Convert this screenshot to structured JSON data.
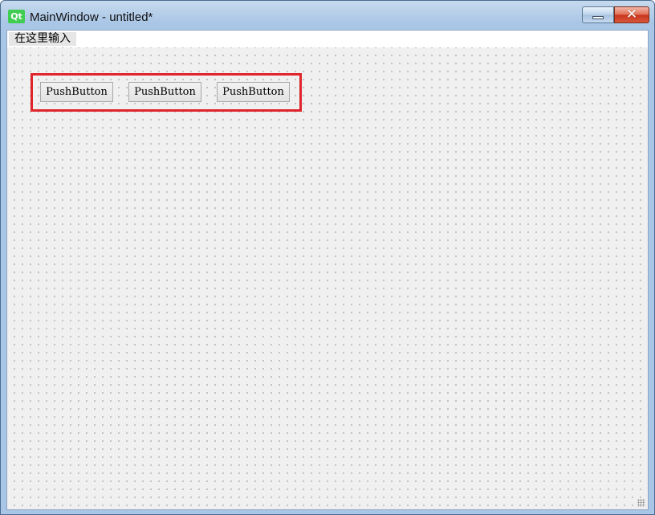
{
  "window": {
    "title": "MainWindow - untitled*",
    "app_icon_text": "Qt",
    "minimize_glyph": "",
    "close_glyph": "✕"
  },
  "menubar": {
    "items": [
      {
        "label": "在这里输入"
      }
    ]
  },
  "form": {
    "buttons": [
      {
        "label": "PushButton"
      },
      {
        "label": "PushButton"
      },
      {
        "label": "PushButton"
      }
    ]
  },
  "colors": {
    "highlight_border": "#e0242b",
    "qt_green": "#41cd52",
    "close_red": "#c8341c"
  }
}
